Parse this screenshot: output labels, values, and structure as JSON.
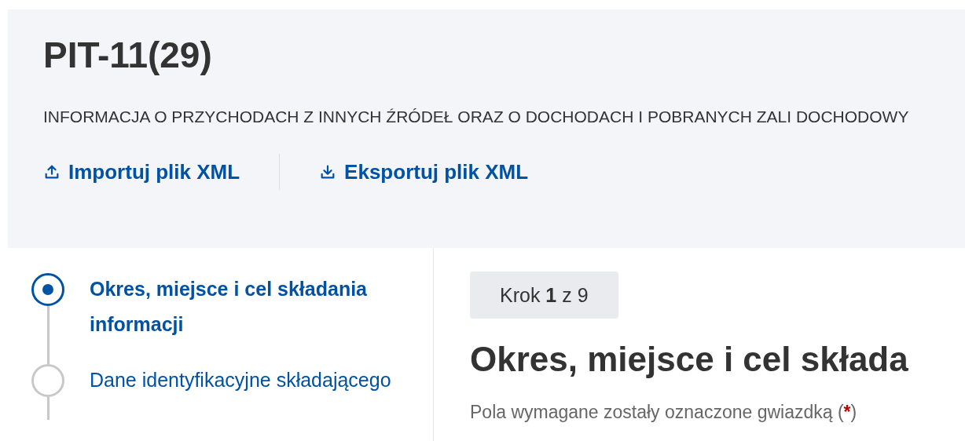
{
  "header": {
    "title": "PIT-11(29)",
    "description": "INFORMACJA O PRZYCHODACH Z INNYCH ŹRÓDEŁ ORAZ O DOCHODACH I POBRANYCH ZALI DOCHODOWY",
    "actions": [
      {
        "kind": "import",
        "label": "Importuj plik XML"
      },
      {
        "kind": "export",
        "label": "Eksportuj plik XML"
      }
    ]
  },
  "steps": [
    {
      "label": "Okres, miejsce i cel składania informacji",
      "selected": true
    },
    {
      "label": "Dane identyfikacyjne składającego",
      "selected": false
    }
  ],
  "content": {
    "step_badge": "Krok **1** z 9",
    "heading": "Okres, miejsce i cel składa",
    "required_note": "Pola wymagane zostały oznaczone gwiazdką (",
    "required_mark": "*",
    "required_note_end": ")"
  }
}
